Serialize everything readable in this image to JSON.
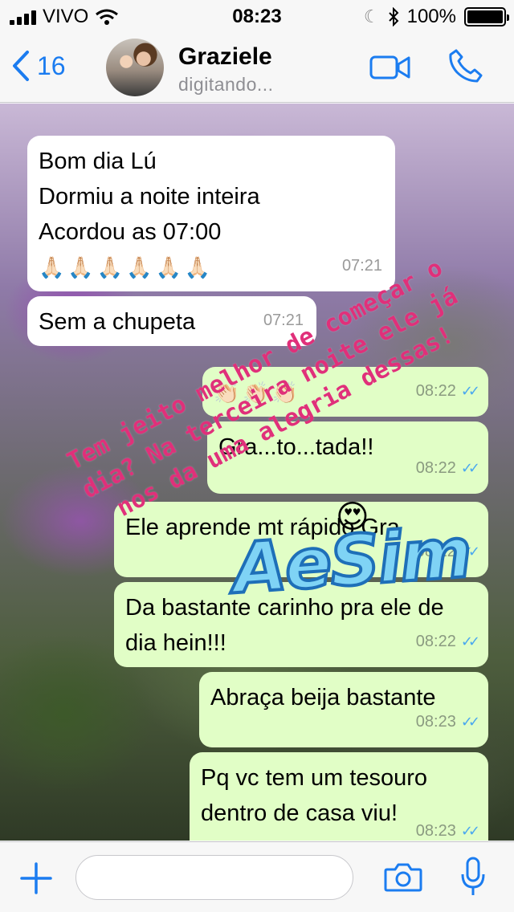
{
  "status_bar": {
    "carrier": "VIVO",
    "time": "08:23",
    "battery": "100%"
  },
  "header": {
    "back_count": "16",
    "contact_name": "Graziele",
    "contact_status": "digitando..."
  },
  "messages": [
    {
      "direction": "in",
      "lines": [
        "Bom dia Lú",
        "Dormiu a noite inteira",
        "Acordou as 07:00"
      ],
      "emoji": "🙏🏻🙏🏻🙏🏻🙏🏻🙏🏻🙏🏻",
      "time": "07:21"
    },
    {
      "direction": "in",
      "text": "Sem a chupeta",
      "time": "07:21"
    },
    {
      "direction": "out",
      "emoji": "👏🏻👏🏻👏🏻",
      "time": "08:22"
    },
    {
      "direction": "out",
      "text": "Gra...to...tada!!",
      "time": "08:22"
    },
    {
      "direction": "out",
      "text": "Ele aprende mt rápido Gra",
      "time": "08:22"
    },
    {
      "direction": "out",
      "text": "Da bastante carinho pra ele de dia hein!!!",
      "time": "08:22"
    },
    {
      "direction": "out",
      "text": "Abraça beija bastante",
      "time": "08:23"
    },
    {
      "direction": "out",
      "text": "Pq vc tem um tesouro dentro de casa viu!",
      "time": "08:23"
    }
  ],
  "overlay": {
    "text": "Tem jeito melhor de começar o dia? Na terceira noite ele já nos da uma alegria dessas!",
    "sticker": "AeSim",
    "heart_emoji": "😍"
  },
  "input": {
    "placeholder": ""
  },
  "colors": {
    "accent": "#1b7cf0",
    "outgoing_bubble": "#e1fec6",
    "incoming_bubble": "#ffffff",
    "read_ticks": "#4aa8ef",
    "overlay_text": "#e0307a"
  }
}
